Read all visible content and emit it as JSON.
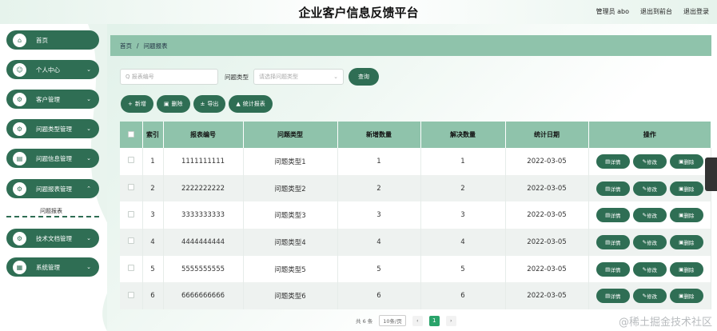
{
  "header": {
    "title": "企业客户信息反馈平台",
    "links": [
      "管理员 abo",
      "退出到前台",
      "退出登录"
    ]
  },
  "sidebar": {
    "items": [
      {
        "label": "首页",
        "icon": "home-icon",
        "glyph": "⌂",
        "arrow": ""
      },
      {
        "label": "个人中心",
        "icon": "user-icon",
        "glyph": "☺",
        "arrow": "⌄"
      },
      {
        "label": "客户管理",
        "icon": "gear-icon",
        "glyph": "⚙",
        "arrow": "⌄"
      },
      {
        "label": "问题类型管理",
        "icon": "gear-icon",
        "glyph": "⚙",
        "arrow": "⌄"
      },
      {
        "label": "问题信息管理",
        "icon": "doc-icon",
        "glyph": "▤",
        "arrow": "⌄"
      },
      {
        "label": "问题报表管理",
        "icon": "gear-icon",
        "glyph": "⚙",
        "arrow": "⌃"
      },
      {
        "label": "技术文档管理",
        "icon": "gear-icon",
        "glyph": "⚙",
        "arrow": "⌄"
      },
      {
        "label": "系统管理",
        "icon": "grid-icon",
        "glyph": "▦",
        "arrow": "⌄"
      }
    ],
    "sub_item": "问题报表"
  },
  "breadcrumb": {
    "home": "首页",
    "sep": "/",
    "current": "问题报表"
  },
  "search": {
    "input_placeholder": "Q 报表编号",
    "type_label": "问题类型",
    "select_placeholder": "请选择问题类型",
    "query_label": "查询"
  },
  "actions": [
    {
      "label": "新增",
      "glyph": "+"
    },
    {
      "label": "删除",
      "glyph": "▣"
    },
    {
      "label": "导出",
      "glyph": "±"
    },
    {
      "label": "统计报表",
      "glyph": "▲"
    }
  ],
  "table": {
    "headers": [
      "",
      "索引",
      "报表编号",
      "问题类型",
      "新增数量",
      "解决数量",
      "统计日期",
      "操作"
    ],
    "rows": [
      {
        "index": "1",
        "code": "1111111111",
        "type": "问题类型1",
        "added": "1",
        "solved": "1",
        "date": "2022-03-05"
      },
      {
        "index": "2",
        "code": "2222222222",
        "type": "问题类型2",
        "added": "2",
        "solved": "2",
        "date": "2022-03-05"
      },
      {
        "index": "3",
        "code": "3333333333",
        "type": "问题类型3",
        "added": "3",
        "solved": "3",
        "date": "2022-03-05"
      },
      {
        "index": "4",
        "code": "4444444444",
        "type": "问题类型4",
        "added": "4",
        "solved": "4",
        "date": "2022-03-05"
      },
      {
        "index": "5",
        "code": "5555555555",
        "type": "问题类型5",
        "added": "5",
        "solved": "5",
        "date": "2022-03-05"
      },
      {
        "index": "6",
        "code": "6666666666",
        "type": "问题类型6",
        "added": "6",
        "solved": "6",
        "date": "2022-03-05"
      }
    ],
    "row_buttons": [
      "详情",
      "修改",
      "删除"
    ]
  },
  "pagination": {
    "total": "共 6 条",
    "page_size": "10条/页",
    "current_page": "1"
  },
  "watermark": "@稀土掘金技术社区",
  "colors": {
    "primary": "#2f6e54",
    "header_bg": "#8fc3ab",
    "active_page": "#29a36a"
  }
}
